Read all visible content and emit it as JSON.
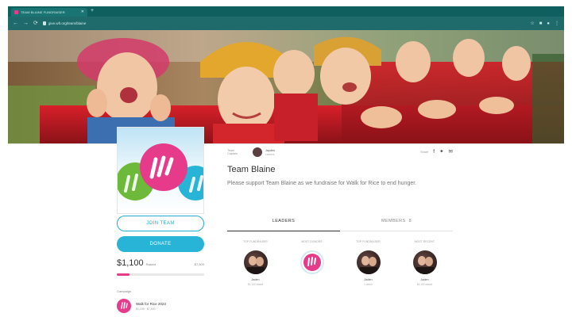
{
  "browser": {
    "tab_title": "TEAM BLAINE FUNDRAISER",
    "url": "give.wfr.org/team/blaine",
    "colors": {
      "tab_bar": "#0f5f5f",
      "address_bar": "#1f6b6b"
    }
  },
  "sidebar": {
    "join_label": "JOIN TEAM",
    "donate_label": "DONATE",
    "raised_amount": "$1,100",
    "raised_label": "Raised",
    "goal_amount": "$7,500",
    "progress_fraction": 0.147,
    "campaign_heading": "Campaign",
    "campaign_name": "Walk for Rice 2023",
    "campaign_sub": "$1,100 · $7,500"
  },
  "team": {
    "captain_label": "Team Captain",
    "captain_name": "Jayden",
    "captain_sub": "Leaders",
    "share_label": "Share",
    "share_icons": [
      "facebook-icon",
      "twitter-icon",
      "email-icon"
    ],
    "title": "Team Blaine",
    "description": "Please support Team Blaine as we fundraise for Walk for Rice to end hunger."
  },
  "tabs": {
    "leaders": "LEADERS",
    "members": "MEMBERS",
    "members_count": "8"
  },
  "leaders": [
    {
      "label": "TOP FUNDRAISER",
      "name": "Jaden",
      "amount": "$1,100 raised",
      "avatar": "photo"
    },
    {
      "label": "MOST DONORS",
      "name": "",
      "amount": "",
      "avatar": "logo"
    },
    {
      "label": "TOP FUNDRAISER",
      "name": "Jaden",
      "amount": "1 donor",
      "avatar": "photo"
    },
    {
      "label": "MOST RECENT",
      "name": "Jaden",
      "amount": "$1,100 raised",
      "avatar": "photo"
    }
  ],
  "colors": {
    "accent_pink": "#e63a8b",
    "accent_blue": "#27b4d6",
    "accent_green": "#6dba3a"
  }
}
